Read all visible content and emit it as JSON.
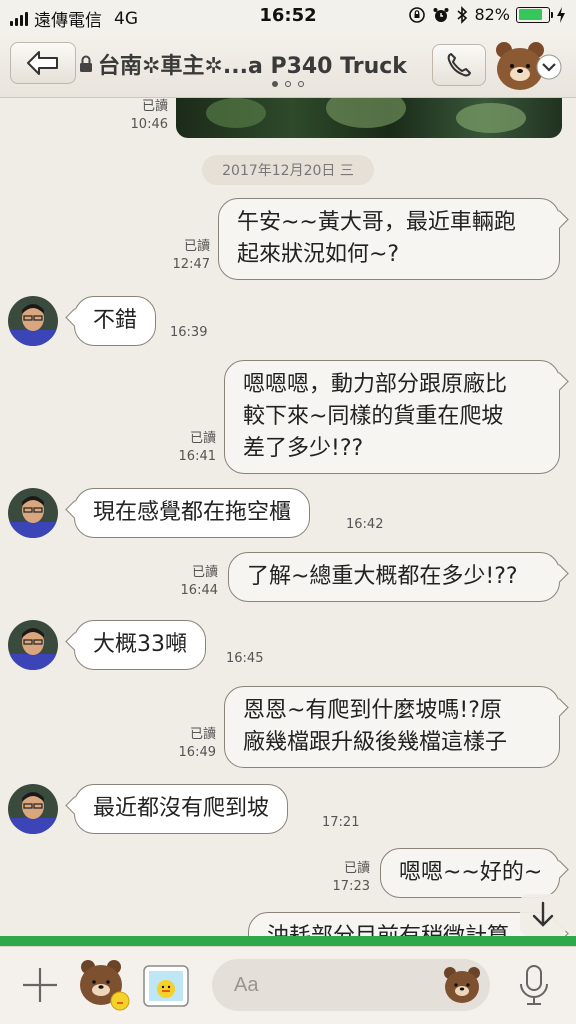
{
  "status_bar": {
    "carrier": "遠傳電信",
    "network": "4G",
    "time": "16:52",
    "battery_percent": "82%",
    "battery_level": 0.82
  },
  "header": {
    "title": "台南✲車主✲...a P340 Truck",
    "back_icon": "arrow-left-icon",
    "lock_icon": "lock-icon",
    "call_icon": "phone-icon",
    "menu_icon": "chevron-down-icon",
    "page_indicator": {
      "total": 3,
      "active": 1
    }
  },
  "chat": {
    "top_photo": {
      "read": "已讀",
      "time": "10:46"
    },
    "date_separator": "2017年12月20日 三",
    "messages": [
      {
        "side": "out",
        "lines": [
          "午安~~黃大哥，最近車輛跑",
          "起來狀況如何~?"
        ],
        "read": "已讀",
        "time": "12:47"
      },
      {
        "side": "in",
        "lines": [
          "不錯"
        ],
        "time": "16:39"
      },
      {
        "side": "out",
        "lines": [
          "嗯嗯嗯，動力部分跟原廠比",
          "較下來~同樣的貨重在爬坡",
          "差了多少!??"
        ],
        "read": "已讀",
        "time": "16:41"
      },
      {
        "side": "in",
        "lines": [
          "現在感覺都在拖空櫃"
        ],
        "time": "16:42"
      },
      {
        "side": "out",
        "lines": [
          "了解~總重大概都在多少!??"
        ],
        "read": "已讀",
        "time": "16:44"
      },
      {
        "side": "in",
        "lines": [
          "大概33噸"
        ],
        "time": "16:45"
      },
      {
        "side": "out",
        "lines": [
          "恩恩~有爬到什麼坡嗎!?原",
          "廠幾檔跟升級後幾檔這樣子"
        ],
        "read": "已讀",
        "time": "16:49"
      },
      {
        "side": "in",
        "lines": [
          "最近都沒有爬到坡"
        ],
        "time": "17:21"
      },
      {
        "side": "out",
        "lines": [
          "嗯嗯~~好的~"
        ],
        "read": "已讀",
        "time": "17:23"
      },
      {
        "side": "out",
        "lines": [
          "油耗部分目前有稍微計算"
        ],
        "read": "",
        "time": ""
      }
    ]
  },
  "input_bar": {
    "placeholder": "Aa",
    "plus_icon": "plus-icon",
    "sticker_icon": "bear-sticker-icon",
    "photo_icon": "photo-icon",
    "emoji_icon": "bear-emoji-icon",
    "mic_icon": "microphone-icon"
  },
  "scroll_icon": "arrow-down-icon",
  "colors": {
    "background": "#f0ece6",
    "bubble_border": "#8a8378",
    "accent_green": "#2ea84a",
    "battery_green": "#35c759"
  }
}
